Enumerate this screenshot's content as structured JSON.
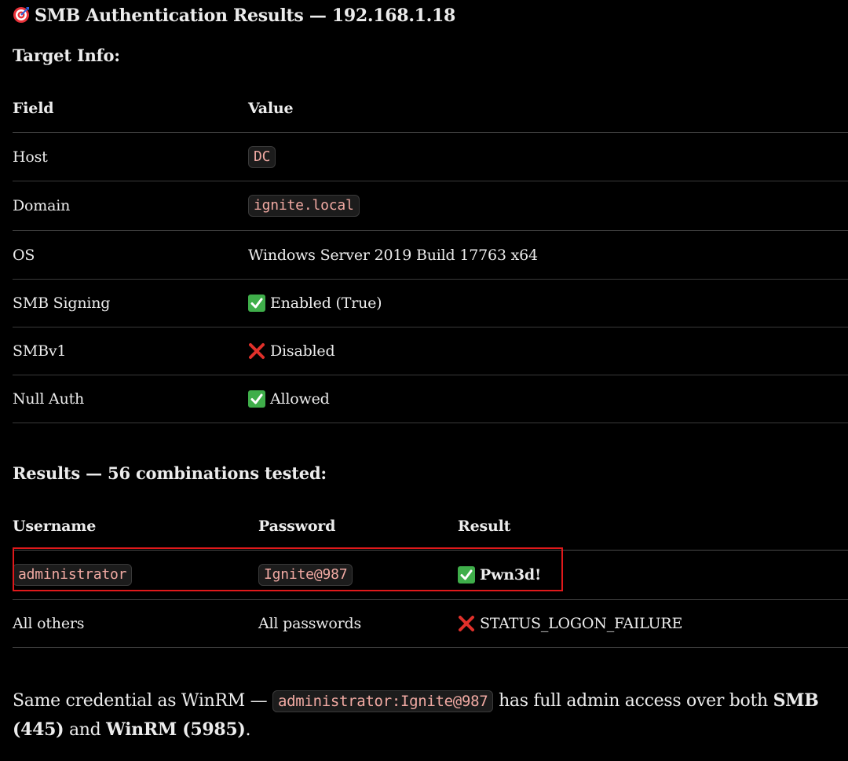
{
  "title": "SMB Authentication Results — 192.168.1.18",
  "target_info": {
    "heading": "Target Info:",
    "columns": [
      "Field",
      "Value"
    ],
    "rows": [
      {
        "field": "Host",
        "value": "DC",
        "value_style": "code"
      },
      {
        "field": "Domain",
        "value": "ignite.local",
        "value_style": "code"
      },
      {
        "field": "OS",
        "value": "Windows Server 2019 Build 17763 x64",
        "value_style": "text"
      },
      {
        "field": "SMB Signing",
        "value": "Enabled (True)",
        "value_style": "text",
        "icon": "check-icon"
      },
      {
        "field": "SMBv1",
        "value": "Disabled",
        "value_style": "text",
        "icon": "cross-icon"
      },
      {
        "field": "Null Auth",
        "value": "Allowed",
        "value_style": "text",
        "icon": "check-icon"
      }
    ]
  },
  "results": {
    "heading": "Results — 56 combinations tested:",
    "columns": [
      "Username",
      "Password",
      "Result"
    ],
    "rows": [
      {
        "username": "administrator",
        "password": "Ignite@987",
        "result": "Pwn3d!",
        "icon": "check-icon",
        "code": true,
        "highlighted": true
      },
      {
        "username": "All others",
        "password": "All passwords",
        "result": "STATUS_LOGON_FAILURE",
        "icon": "cross-icon",
        "code": false,
        "highlighted": false
      }
    ]
  },
  "note": {
    "prefix": "Same credential as WinRM — ",
    "credential": "administrator:Ignite@987",
    "middle": " has full admin access over both ",
    "smb": "SMB (445)",
    "and": " and ",
    "winrm": "WinRM (5985)",
    "suffix": "."
  },
  "colors": {
    "background": "#000000",
    "text": "#ececec",
    "code_text": "#f0a9a2",
    "highlight_border": "#e0191b",
    "check_green": "#3fae4a",
    "cross_red": "#e0302a"
  }
}
